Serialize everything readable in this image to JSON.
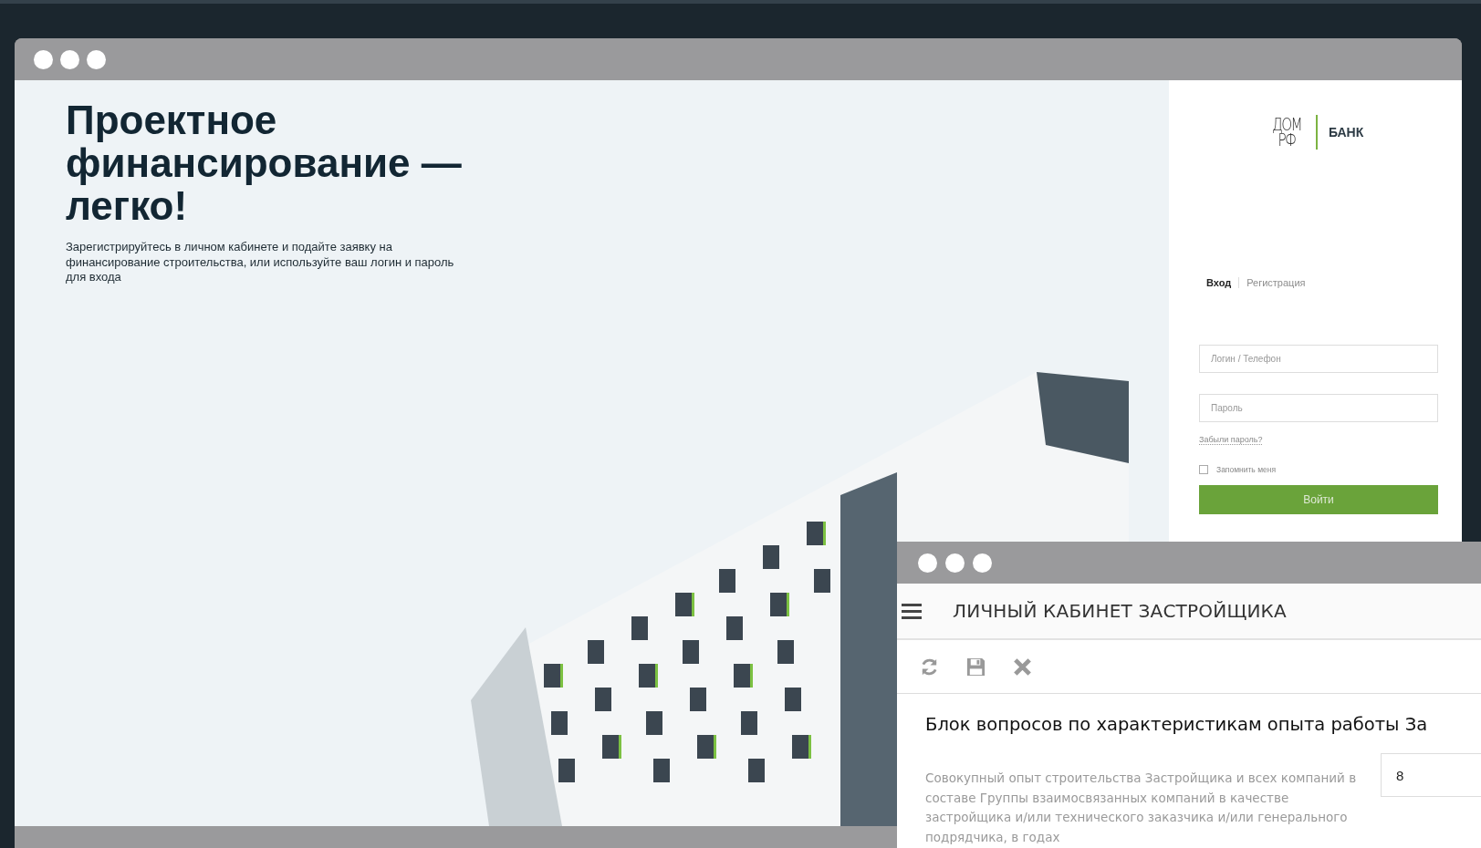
{
  "login_window": {
    "hero": {
      "title": "Проектное финансирование — легко!",
      "description": "Зарегистрируйтесь в личном кабинете и подайте заявку на финансирование строительства, или используйте ваш логин и пароль для входа"
    },
    "logo": {
      "mark_lines": [
        "ДОМ",
        "РФ"
      ],
      "name": "БАНК"
    },
    "tabs": [
      {
        "label": "Вход",
        "selected": true
      },
      {
        "label": "Регистрация",
        "selected": false
      }
    ],
    "fields": [
      {
        "placeholder": "Логин / Телефон"
      },
      {
        "placeholder": "Пароль"
      }
    ],
    "forgot_link": "Забыли пароль?",
    "remember": {
      "label": "Запомнить меня",
      "checked": false
    },
    "submit": "Войти"
  },
  "cabinet_window": {
    "title": "ЛИЧНЫЙ КАБИНЕТ ЗАСТРОЙЩИКА",
    "section_title": "Блок вопросов по характеристикам опыта работы За",
    "question": {
      "label": "Совокупный опыт строительства Застройщика и всех компаний в составе Группы взаимосвязанных компаний в качестве застройщика и/или технического заказчика и/или генерального подрядчика, в годах",
      "value": "8"
    }
  }
}
